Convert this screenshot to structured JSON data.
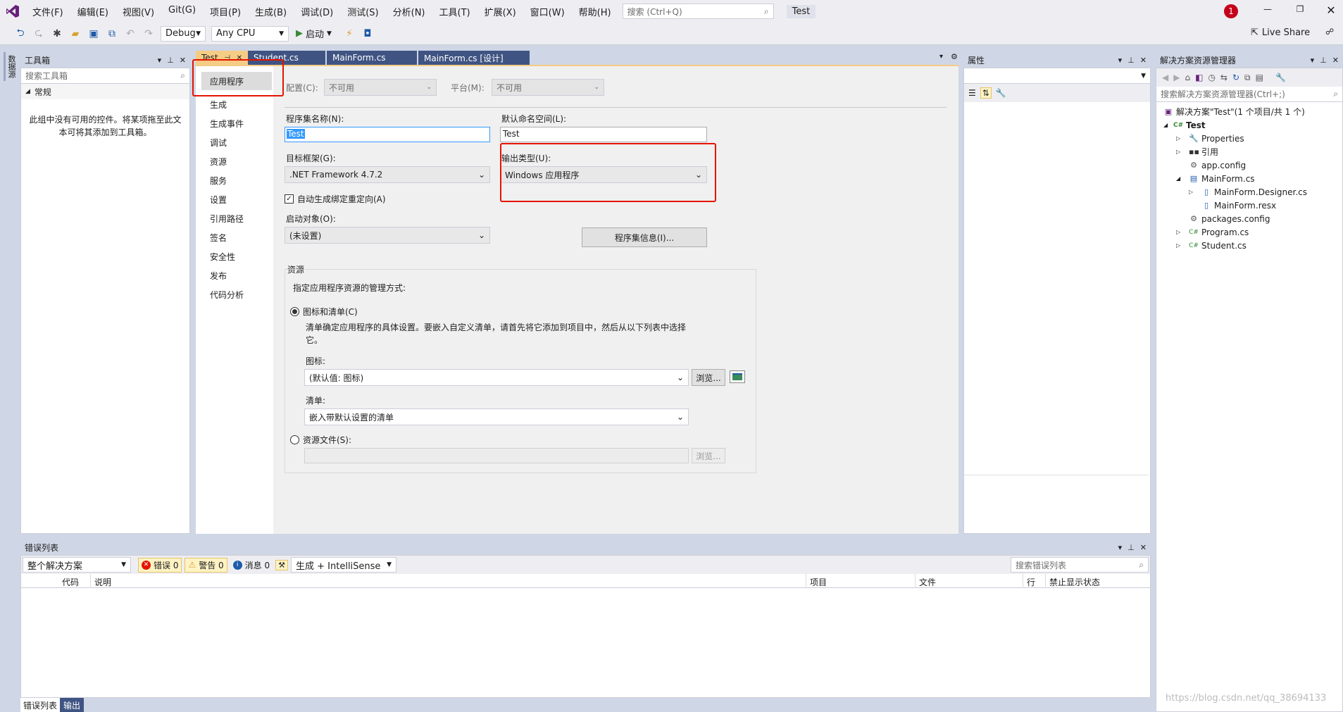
{
  "menu": {
    "items": [
      "文件(F)",
      "编辑(E)",
      "视图(V)",
      "Git(G)",
      "项目(P)",
      "生成(B)",
      "调试(D)",
      "测试(S)",
      "分析(N)",
      "工具(T)",
      "扩展(X)",
      "窗口(W)",
      "帮助(H)"
    ],
    "search_placeholder": "搜索 (Ctrl+Q)",
    "solution_name": "Test",
    "notification_count": "1"
  },
  "toolbar": {
    "config": "Debug",
    "platform": "Any CPU",
    "start_label": "启动",
    "live_share": "Live Share"
  },
  "toolbox": {
    "title": "工具箱",
    "search_placeholder": "搜索工具箱",
    "group": "常规",
    "empty_message": "此组中没有可用的控件。将某项拖至此文本可将其添加到工具箱。",
    "side_label": "数据源"
  },
  "tabs": [
    {
      "label": "Test"
    },
    {
      "label": "Student.cs"
    },
    {
      "label": "MainForm.cs"
    },
    {
      "label": "MainForm.cs [设计]"
    }
  ],
  "nav": [
    "应用程序",
    "生成",
    "生成事件",
    "调试",
    "资源",
    "服务",
    "设置",
    "引用路径",
    "签名",
    "安全性",
    "发布",
    "代码分析"
  ],
  "props": {
    "config_label": "配置(C):",
    "config_value": "不可用",
    "platform_label": "平台(M):",
    "platform_value": "不可用",
    "assembly_name_label": "程序集名称(N):",
    "assembly_name_value": "Test",
    "namespace_label": "默认命名空间(L):",
    "namespace_value": "Test",
    "framework_label": "目标框架(G):",
    "framework_value": ".NET Framework 4.7.2",
    "output_type_label": "输出类型(U):",
    "output_type_value": "Windows 应用程序",
    "auto_redirect_label": "自动生成绑定重定向(A)",
    "startup_label": "启动对象(O):",
    "startup_value": "(未设置)",
    "assembly_info_btn": "程序集信息(I)...",
    "resources_group": "资源",
    "resources_desc": "指定应用程序资源的管理方式:",
    "icon_manifest_label": "图标和清单(C)",
    "icon_manifest_desc": "清单确定应用程序的具体设置。要嵌入自定义清单，请首先将它添加到项目中，然后从以下列表中选择它。",
    "icon_label": "图标:",
    "icon_value": "(默认值: 图标)",
    "browse_label": "浏览...",
    "manifest_label": "清单:",
    "manifest_value": "嵌入带默认设置的清单",
    "resource_file_label": "资源文件(S):"
  },
  "properties_panel": {
    "title": "属性"
  },
  "solution": {
    "title": "解决方案资源管理器",
    "search_placeholder": "搜索解决方案资源管理器(Ctrl+;)",
    "root": "解决方案\"Test\"(1 个项目/共 1 个)",
    "project": "Test",
    "items": [
      {
        "label": "Properties",
        "icon": "wrench-icon",
        "level": 2,
        "expander": "▷"
      },
      {
        "label": "引用",
        "icon": "references-icon",
        "level": 2,
        "expander": "▷"
      },
      {
        "label": "app.config",
        "icon": "config-icon",
        "level": 2,
        "expander": ""
      },
      {
        "label": "MainForm.cs",
        "icon": "form-icon",
        "level": 2,
        "expander": "◢"
      },
      {
        "label": "MainForm.Designer.cs",
        "icon": "file-icon",
        "level": 3,
        "expander": "▷"
      },
      {
        "label": "MainForm.resx",
        "icon": "file-icon",
        "level": 3,
        "expander": ""
      },
      {
        "label": "packages.config",
        "icon": "config-icon",
        "level": 2,
        "expander": ""
      },
      {
        "label": "Program.cs",
        "icon": "csharp-icon",
        "level": 2,
        "expander": "▷"
      },
      {
        "label": "Student.cs",
        "icon": "csharp-icon",
        "level": 2,
        "expander": "▷"
      }
    ]
  },
  "errors": {
    "title": "错误列表",
    "scope": "整个解决方案",
    "errors_label": "错误 0",
    "warnings_label": "警告 0",
    "messages_label": "消息 0",
    "build_filter": "生成 + IntelliSense",
    "search_placeholder": "搜索错误列表",
    "columns": [
      "代码",
      "说明",
      "项目",
      "文件",
      "行",
      "禁止显示状态"
    ],
    "bottom_tabs": [
      "错误列表",
      "输出"
    ]
  },
  "watermark": "https://blog.csdn.net/qq_38694133",
  "colors": {
    "accent": "#68217a",
    "highlight_red": "#e51400",
    "active_tab": "#f5cc84",
    "tab_bg": "#3f5483"
  }
}
